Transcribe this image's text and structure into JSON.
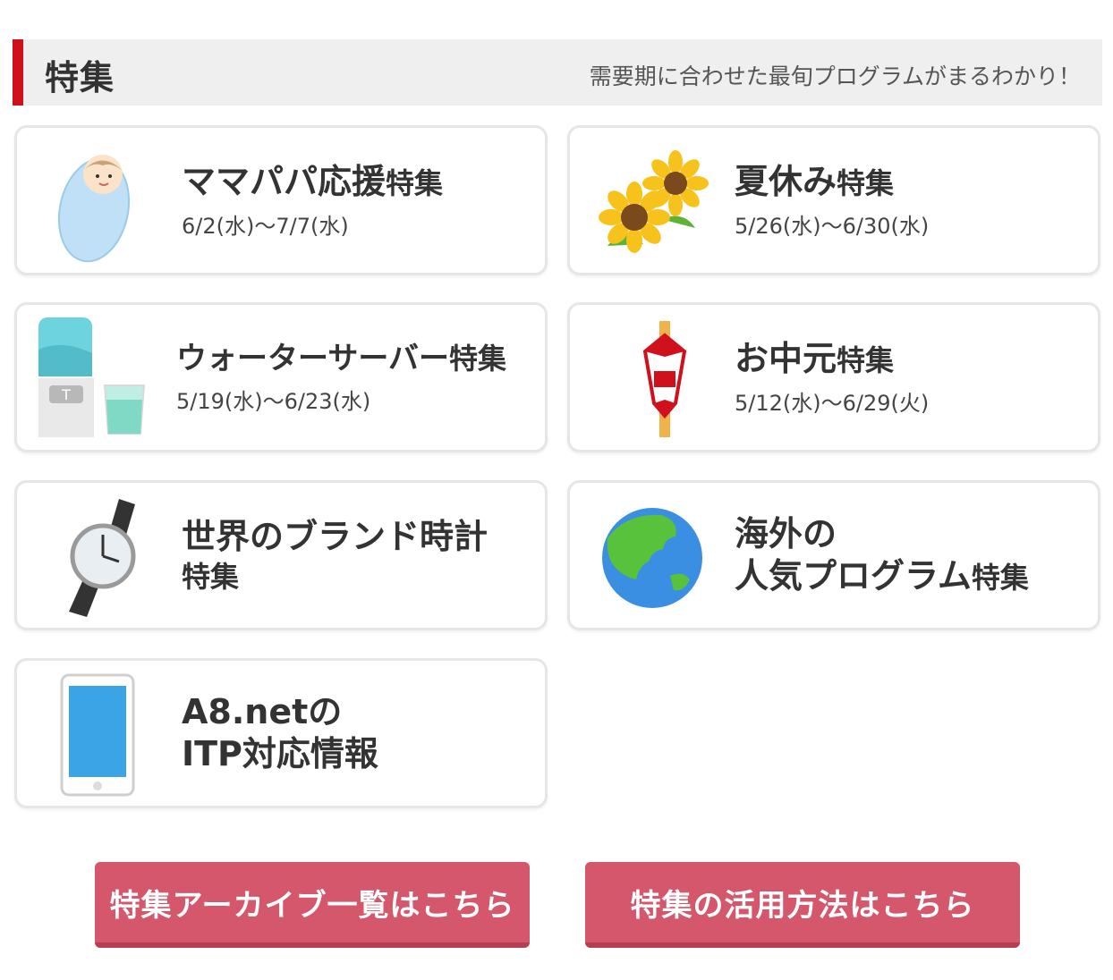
{
  "header": {
    "title": "特集",
    "subtitle": "需要期に合わせた最旬プログラムがまるわかり！"
  },
  "cards": [
    {
      "title_main": "ママパパ応援",
      "title_small": "特集",
      "date": "6/2(水)〜7/7(水)",
      "icon": "baby-icon"
    },
    {
      "title_main": "夏休み",
      "title_small": "特集",
      "date": "5/26(水)〜6/30(水)",
      "icon": "sunflower-icon"
    },
    {
      "title_main": "ウォーターサーバー",
      "title_small": "特集",
      "date": "5/19(水)〜6/23(水)",
      "icon": "water-server-icon"
    },
    {
      "title_main": "お中元",
      "title_small": "特集",
      "date": "5/12(水)〜6/29(火)",
      "icon": "gift-noshi-icon"
    },
    {
      "title_line1": "世界のブランド時計",
      "title_line2": "特集",
      "icon": "wristwatch-icon"
    },
    {
      "title_line1": "海外の",
      "title_line2_main": "人気プログラム",
      "title_line2_small": "特集",
      "icon": "globe-icon"
    },
    {
      "title_line1": "A8.netの",
      "title_line2": "ITP対応情報",
      "icon": "smartphone-icon"
    }
  ],
  "buttons": {
    "archive": "特集アーカイブ一覧はこちら",
    "howto": "特集の活用方法はこちら"
  },
  "colors": {
    "accent": "#d0101b",
    "button": "#d4576b"
  }
}
